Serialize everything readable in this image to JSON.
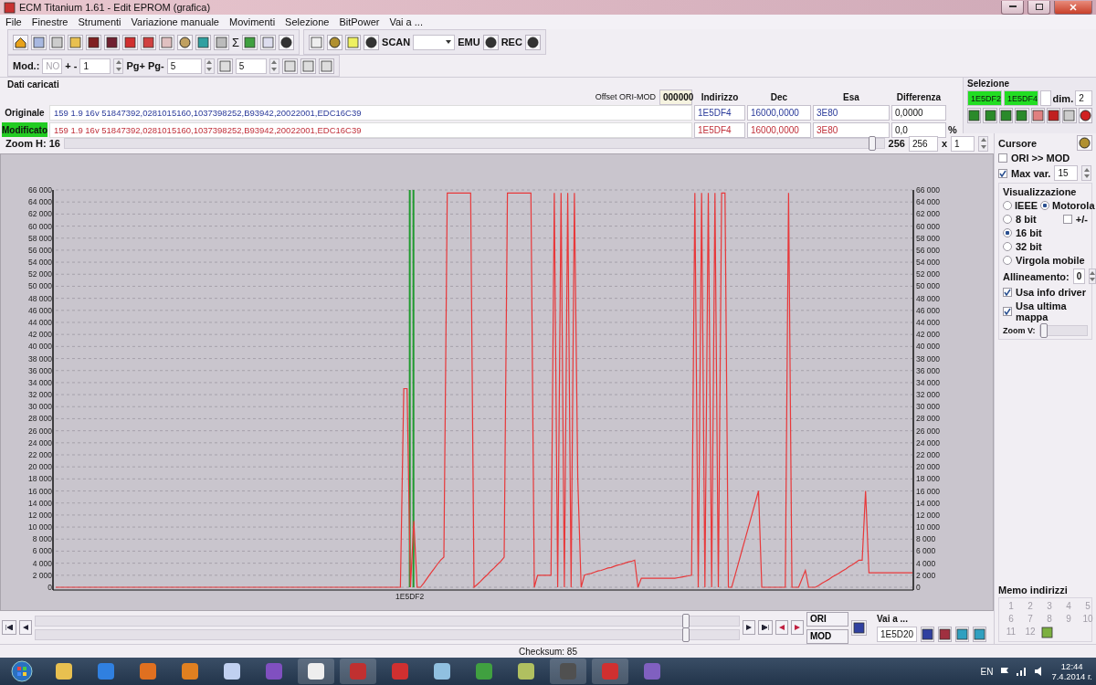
{
  "window": {
    "title": "ECM Titanium 1.61 - Edit EPROM (grafica)"
  },
  "menu": [
    "File",
    "Finestre",
    "Strumenti",
    "Variazione manuale",
    "Movimenti",
    "Selezione",
    "BitPower",
    "Vai a ..."
  ],
  "toolbar": {
    "sigma_icon": "Σ",
    "scan_label": "SCAN",
    "emu_label": "EMU",
    "rec_label": "REC"
  },
  "toolbar2": {
    "mod_label": "Mod.:",
    "mod_value": "NO",
    "step_label": "+ -",
    "step_value": "1",
    "page_label": "Pg+ Pg-",
    "page_value": "5",
    "p_value": "5"
  },
  "data": {
    "title": "Dati caricati",
    "offset_label": "Offset ORI-MOD",
    "offset_value": "000000",
    "columns": [
      "Indirizzo",
      "Dec",
      "Esa",
      "Differenza"
    ],
    "rows": [
      {
        "kind": "original",
        "label": "Originale",
        "description": "159 1.9 16v 51847392,0281015160,1037398252,B93942,20022001,EDC16C39",
        "address": "1E5DF4",
        "dec": "16000,0000",
        "hex": "3E80",
        "diff": "0,0000"
      },
      {
        "kind": "modified",
        "label": "Modificato",
        "description": "159 1.9 16v 51847392,0281015160,1037398252,B93942,20022001,EDC16C39",
        "address": "1E5DF4",
        "dec": "16000,0000",
        "hex": "3E80",
        "diff": "0,0",
        "unit": "%"
      }
    ]
  },
  "selection": {
    "title": "Selezione",
    "start": "1E5DF2",
    "end": "1E5DF4",
    "dim_label": "dim.",
    "dim_value": "2"
  },
  "zoom": {
    "label": "Zoom H: 16",
    "level": 0.99,
    "value_a": "256",
    "value_b": "256",
    "times": "x",
    "factor": "1"
  },
  "chart_cursor": {
    "label": "1E5DF2"
  },
  "chart_data": {
    "type": "line",
    "grid": true,
    "ylim": [
      0,
      66000
    ],
    "yticks": [
      {
        "value": 0,
        "label": "0"
      },
      {
        "value": 2000,
        "label": "2 000"
      },
      {
        "value": 4000,
        "label": "4 000"
      },
      {
        "value": 6000,
        "label": "6 000"
      },
      {
        "value": 8000,
        "label": "8 000"
      },
      {
        "value": 10000,
        "label": "10 000"
      },
      {
        "value": 12000,
        "label": "12 000"
      },
      {
        "value": 14000,
        "label": "14 000"
      },
      {
        "value": 16000,
        "label": "16 000"
      },
      {
        "value": 18000,
        "label": "18 000"
      },
      {
        "value": 20000,
        "label": "20 000"
      },
      {
        "value": 22000,
        "label": "22 000"
      },
      {
        "value": 24000,
        "label": "24 000"
      },
      {
        "value": 26000,
        "label": "26 000"
      },
      {
        "value": 28000,
        "label": "28 000"
      },
      {
        "value": 30000,
        "label": "30 000"
      },
      {
        "value": 32000,
        "label": "32 000"
      },
      {
        "value": 34000,
        "label": "34 000"
      },
      {
        "value": 36000,
        "label": "36 000"
      },
      {
        "value": 38000,
        "label": "38 000"
      },
      {
        "value": 40000,
        "label": "40 000"
      },
      {
        "value": 42000,
        "label": "42 000"
      },
      {
        "value": 44000,
        "label": "44 000"
      },
      {
        "value": 46000,
        "label": "46 000"
      },
      {
        "value": 48000,
        "label": "48 000"
      },
      {
        "value": 50000,
        "label": "50 000"
      },
      {
        "value": 52000,
        "label": "52 000"
      },
      {
        "value": 54000,
        "label": "54 000"
      },
      {
        "value": 56000,
        "label": "56 000"
      },
      {
        "value": 58000,
        "label": "58 000"
      },
      {
        "value": 60000,
        "label": "60 000"
      },
      {
        "value": 62000,
        "label": "62 000"
      },
      {
        "value": 64000,
        "label": "64 000"
      },
      {
        "value": 66000,
        "label": "66 000"
      }
    ],
    "series": [
      {
        "color": "#e8383a",
        "values": [
          0,
          0,
          0,
          0,
          0,
          0,
          0,
          0,
          0,
          0,
          0,
          0,
          0,
          0,
          0,
          0,
          0,
          0,
          0,
          0,
          0,
          0,
          0,
          0,
          0,
          0,
          0,
          0,
          0,
          0,
          0,
          0,
          0,
          0,
          0,
          0,
          0,
          0,
          0,
          0,
          0,
          0,
          0,
          0,
          0,
          0,
          0,
          0,
          0,
          0,
          0,
          0,
          0,
          0,
          0,
          0,
          0,
          0,
          0,
          0,
          0,
          0,
          0,
          0,
          0,
          0,
          0,
          0,
          0,
          0,
          0,
          0,
          0,
          0,
          0,
          0,
          0,
          0,
          0,
          0,
          0,
          0,
          0,
          0,
          0,
          0,
          0,
          0,
          0,
          0,
          0,
          0,
          0,
          0,
          0,
          0,
          0,
          0,
          0,
          0,
          0,
          0,
          0,
          0,
          33000,
          33000,
          0,
          11000,
          0,
          0,
          700,
          1500,
          2300,
          3000,
          3800,
          4500,
          5000,
          65500,
          65500,
          65500,
          65500,
          65500,
          65500,
          65500,
          65500,
          0,
          500,
          1000,
          1600,
          2100,
          2700,
          3200,
          3800,
          4300,
          5000,
          65500,
          65500,
          65500,
          65500,
          65500,
          65500,
          65500,
          65500,
          0,
          2000,
          2000,
          2000,
          2000,
          2000,
          65500,
          0,
          65500,
          0,
          65500,
          0,
          65500,
          18000,
          0,
          2000,
          2200,
          2300,
          2500,
          2700,
          2800,
          3000,
          3200,
          3300,
          3500,
          3700,
          3800,
          4000,
          4200,
          4300,
          4500,
          0,
          1500,
          1500,
          1500,
          1500,
          1500,
          1500,
          1500,
          1500,
          1500,
          1500,
          1500,
          1600,
          1700,
          1800,
          1900,
          2000,
          65500,
          0,
          65500,
          0,
          65500,
          0,
          65500,
          0,
          65500,
          65500,
          0,
          0,
          2000,
          4000,
          6000,
          8000,
          10000,
          12000,
          14000,
          16000,
          0,
          0,
          0,
          0,
          0,
          0,
          0,
          0,
          65500,
          0,
          0,
          0,
          1400,
          2800,
          0,
          0,
          0,
          300,
          700,
          1000,
          1300,
          1700,
          2000,
          2300,
          2700,
          3000,
          3400,
          3700,
          4100,
          4500,
          4500,
          16000,
          2400,
          2400,
          2400,
          2400,
          2400,
          2400,
          2400,
          2400,
          2400,
          2400,
          2400,
          2400,
          2400,
          2400
        ]
      }
    ]
  },
  "cursor_panel": {
    "title": "Cursore",
    "options": [
      {
        "label": "ORI >> MOD",
        "checked": false
      },
      {
        "label": "Max var.",
        "checked": true,
        "value": "15"
      }
    ]
  },
  "display": {
    "title": "Visualizzazione",
    "byte_order": [
      {
        "label": "IEEE",
        "selected": false
      },
      {
        "label": "Motorola",
        "selected": true
      }
    ],
    "sign": {
      "label": "+/-",
      "checked": false
    },
    "width": [
      {
        "label": "8 bit",
        "selected": false
      },
      {
        "label": "16 bit",
        "selected": true
      },
      {
        "label": "32 bit",
        "selected": false
      },
      {
        "label": "Virgola mobile",
        "selected": false
      }
    ],
    "align_label": "Allineamento:",
    "align_value": "0",
    "options": [
      {
        "label": "Usa info driver",
        "checked": true
      },
      {
        "label": "Usa ultima mappa",
        "checked": true
      }
    ],
    "zoom_v": {
      "label": "Zoom V:",
      "level": 0
    }
  },
  "memo": {
    "title": "Memo indirizzi",
    "slots": [
      "1",
      "2",
      "3",
      "4",
      "5",
      "6",
      "7",
      "8",
      "9",
      "10",
      "11",
      "12"
    ]
  },
  "navigation": {
    "ori_label": "ORI",
    "mod_label": "MOD",
    "goto_label": "Vai a ...",
    "goto_value": "1E5D20"
  },
  "status_bar": {
    "checksum": "Checksum: 85"
  },
  "taskbar": {
    "language": "EN",
    "time": "12:44",
    "date": "7.4.2014 г."
  }
}
